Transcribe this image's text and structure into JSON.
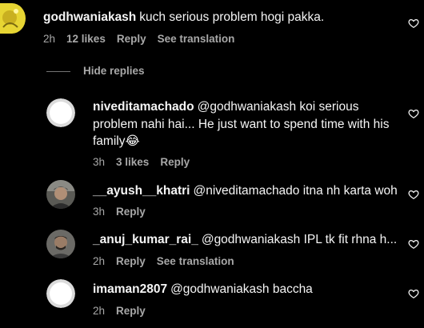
{
  "comment": {
    "username": "godhwaniakash",
    "text": "kuch serious problem hogi pakka.",
    "time": "2h",
    "likes": "12 likes",
    "reply_label": "Reply",
    "translate_label": "See translation"
  },
  "hide_replies_label": "Hide replies",
  "replies": [
    {
      "username": "niveditamachado",
      "text_line1": "@godhwaniakash koi serious",
      "text_line2": "problem nahi hai... He just want to spend time with his",
      "text_line3": "family😂",
      "time": "3h",
      "likes": "3 likes",
      "reply_label": "Reply"
    },
    {
      "username": "__ayush__khatri",
      "text": "@niveditamachado itna nh karta woh",
      "time": "3h",
      "reply_label": "Reply"
    },
    {
      "username": "_anuj_kumar_rai_",
      "text": "@godhwaniakash IPL tk fit rhna h...",
      "time": "2h",
      "reply_label": "Reply",
      "translate_label": "See translation"
    },
    {
      "username": "imaman2807",
      "text": "@godhwaniakash baccha",
      "time": "2h",
      "reply_label": "Reply"
    }
  ],
  "icons": {
    "like": "heart-outline-icon"
  },
  "colors": {
    "background": "#000000",
    "text": "#f5f5f5",
    "meta": "#a8a8a8"
  }
}
